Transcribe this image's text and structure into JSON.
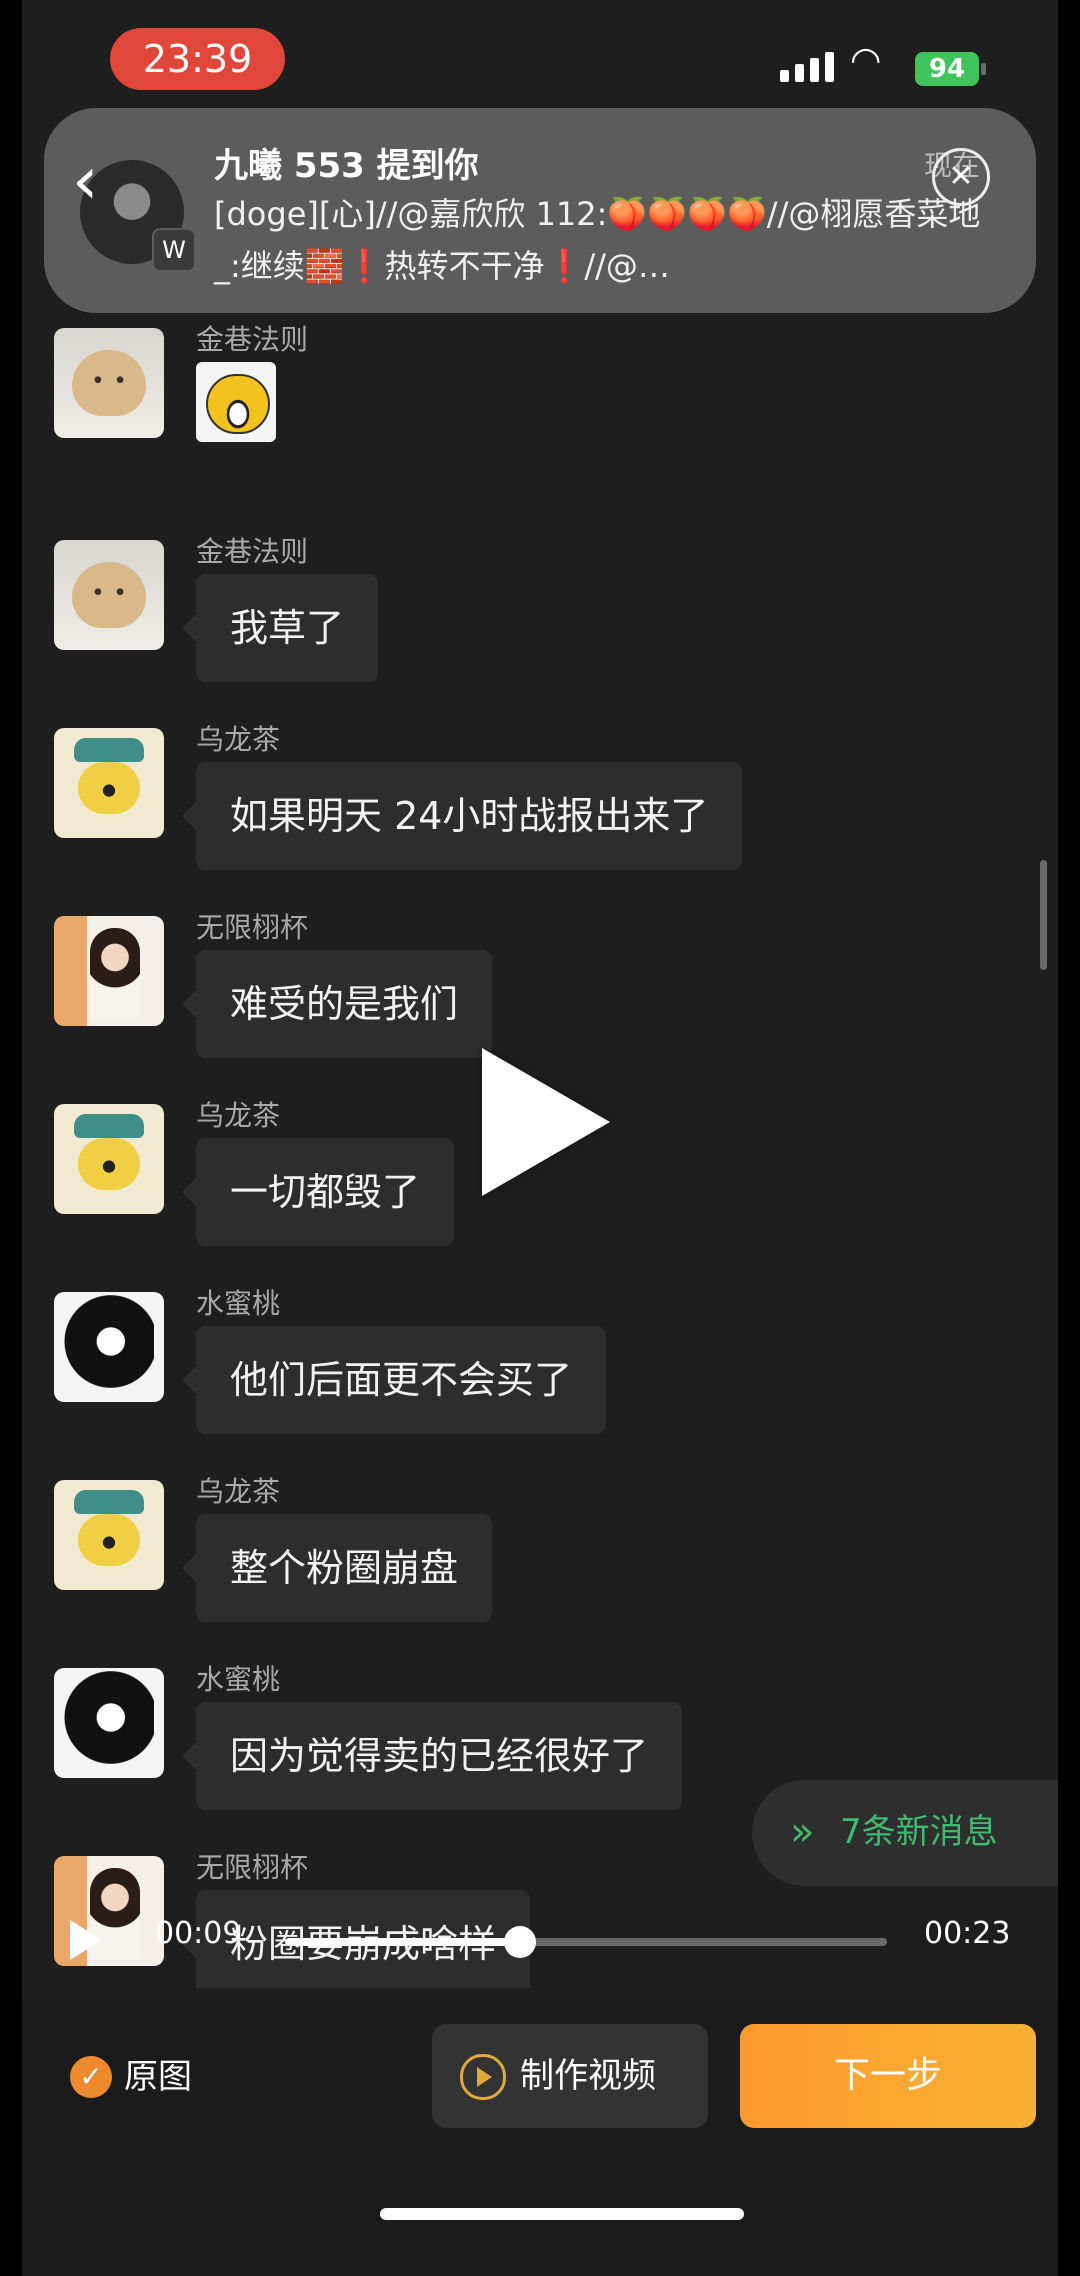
{
  "status_bar": {
    "time": "23:39",
    "battery": "94"
  },
  "notification": {
    "title": "九曦 553 提到你",
    "time": "现在",
    "body": "[doge][心]//@嘉欣欣 112:🍑🍑🍑🍑//@栩愿香菜地_:继续🧱❗热转不干净❗//@…",
    "badge": "W"
  },
  "messages": [
    {
      "user": "金巷法则",
      "avatar": "cat-icon",
      "sticker": true
    },
    {
      "user": "金巷法则",
      "avatar": "cat-icon",
      "text": "我草了"
    },
    {
      "user": "乌龙茶",
      "avatar": "dog-icon",
      "text": "如果明天 24小时战报出来了"
    },
    {
      "user": "无限栩杯",
      "avatar": "girl-photo",
      "text": "难受的是我们"
    },
    {
      "user": "乌龙茶",
      "avatar": "dog-icon",
      "text": "一切都毁了"
    },
    {
      "user": "水蜜桃",
      "avatar": "anime-girl",
      "text": "他们后面更不会买了"
    },
    {
      "user": "乌龙茶",
      "avatar": "dog-icon",
      "text": "整个粉圈崩盘"
    },
    {
      "user": "水蜜桃",
      "avatar": "anime-girl",
      "text": "因为觉得卖的已经很好了"
    },
    {
      "user": "无限栩杯",
      "avatar": "girl-photo",
      "text": "粉圈要崩成啥样"
    }
  ],
  "new_messages": {
    "label": "7条新消息",
    "icon": "double-chevron-down-icon"
  },
  "player": {
    "current": "00:09",
    "total": "00:23",
    "progress": 0.39
  },
  "bottom": {
    "original_label": "原图",
    "make_video_label": "制作视频",
    "next_label": "下一步"
  },
  "colors": {
    "accent": "#ee8a2e",
    "new_message_green": "#3dbb6e",
    "time_pill": "#e0463a",
    "battery": "#3fc35a"
  }
}
